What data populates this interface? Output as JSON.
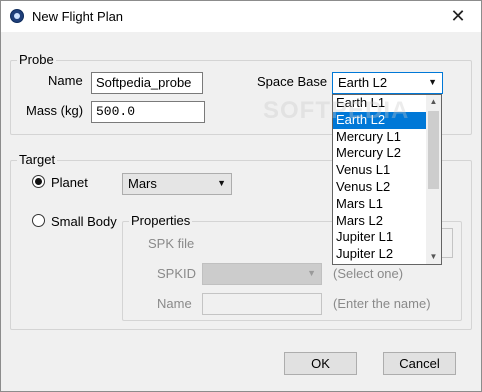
{
  "window": {
    "title": "New Flight Plan",
    "close_glyph": "✕"
  },
  "probe": {
    "legend": "Probe",
    "name_label": "Name",
    "name_value": "Softpedia_probe",
    "mass_label": "Mass (kg)",
    "mass_value": "500.0",
    "space_base_label": "Space Base",
    "space_base_value": "Earth L2",
    "space_base_options": [
      "Earth L1",
      "Earth L2",
      "Mercury L1",
      "Mercury L2",
      "Venus L1",
      "Venus L2",
      "Mars L1",
      "Mars L2",
      "Jupiter L1",
      "Jupiter L2"
    ],
    "space_base_selected_index": 1
  },
  "target": {
    "legend": "Target",
    "planet_label": "Planet",
    "planet_value": "Mars",
    "small_body_label": "Small Body",
    "properties": {
      "legend": "Properties",
      "spk_file_label": "SPK file",
      "spkid_label": "SPKID",
      "spkid_hint": "(Select one)",
      "name_label": "Name",
      "name_hint": "(Enter the name)"
    }
  },
  "buttons": {
    "ok": "OK",
    "cancel": "Cancel"
  },
  "watermark": "SOFTPEDIA",
  "icons": {
    "app": "app-globe-icon",
    "close": "close-icon",
    "dropdown": "chevron-down-icon",
    "scroll_up": "scroll-up-icon",
    "scroll_down": "scroll-down-icon"
  },
  "colors": {
    "selection": "#0078d7",
    "dialog_bg": "#f0f0f0"
  }
}
